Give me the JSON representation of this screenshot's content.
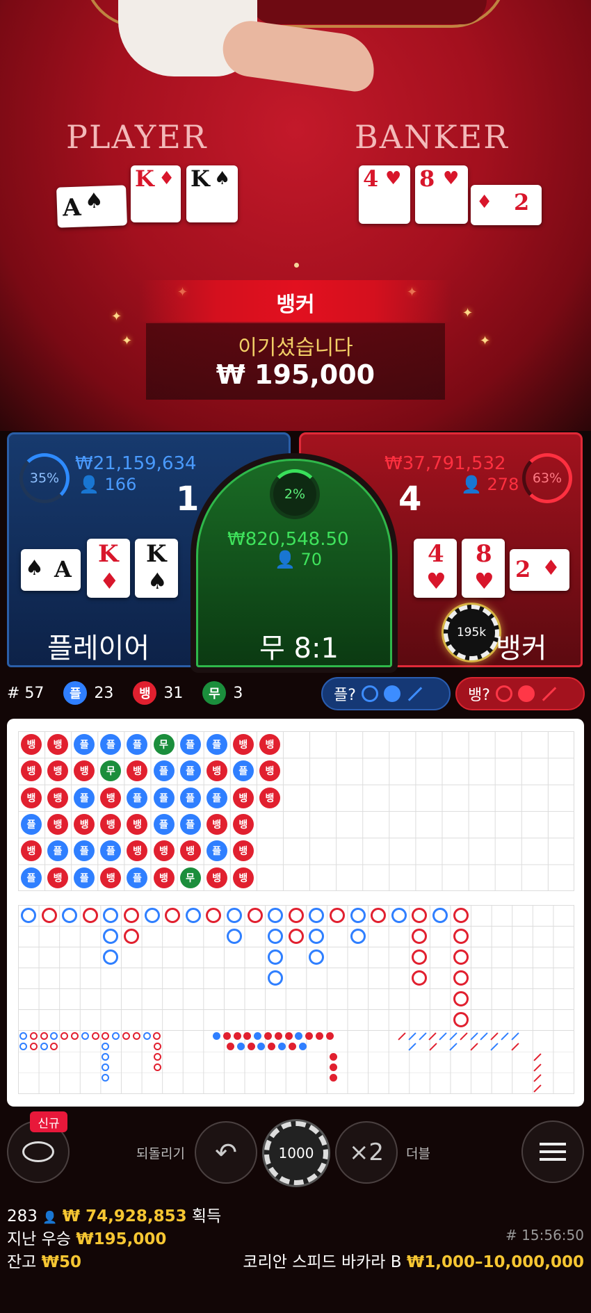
{
  "table": {
    "player_label": "PLAYER",
    "banker_label": "BANKER",
    "player_cards": [
      {
        "rank": "A",
        "suit": "♠",
        "color": "black"
      },
      {
        "rank": "K",
        "suit": "♦",
        "color": "red"
      },
      {
        "rank": "K",
        "suit": "♠",
        "color": "black"
      }
    ],
    "banker_cards": [
      {
        "rank": "4",
        "suit": "♥",
        "color": "red"
      },
      {
        "rank": "8",
        "suit": "♥",
        "color": "red"
      },
      {
        "rank": "2",
        "suit": "♦",
        "color": "red"
      }
    ]
  },
  "result": {
    "winner": "뱅커",
    "message": "이기셨습니다",
    "amount": "₩ 195,000"
  },
  "bets": {
    "player": {
      "pct": "35%",
      "pct_value": 35,
      "amount": "₩21,159,634",
      "players": "166",
      "score": "1",
      "name": "플레이어",
      "cards": [
        {
          "rank": "A",
          "suit": "♠"
        },
        {
          "rank": "K",
          "suit": "♦"
        },
        {
          "rank": "K",
          "suit": "♠"
        }
      ]
    },
    "tie": {
      "pct": "2%",
      "pct_value": 2,
      "amount": "₩820,548.50",
      "players": "70",
      "name": "무 8:1"
    },
    "banker": {
      "pct": "63%",
      "pct_value": 63,
      "amount": "₩37,791,532",
      "players": "278",
      "score": "4",
      "name": "뱅커",
      "chip": "195k",
      "cards": [
        {
          "rank": "4",
          "suit": "♥"
        },
        {
          "rank": "8",
          "suit": "♥"
        },
        {
          "rank": "2",
          "suit": "♦"
        }
      ]
    }
  },
  "stats": {
    "round": "# 57",
    "player_label": "플",
    "player_count": "23",
    "banker_label": "뱅",
    "banker_count": "31",
    "tie_label": "무",
    "tie_count": "3",
    "ask_player": "플?",
    "ask_banker": "뱅?"
  },
  "bead_road": [
    [
      "뱅",
      "뱅",
      "뱅",
      "플",
      "뱅",
      "플"
    ],
    [
      "뱅",
      "뱅",
      "뱅",
      "뱅",
      "플",
      "뱅"
    ],
    [
      "플",
      "뱅",
      "플",
      "뱅",
      "플",
      "플"
    ],
    [
      "플",
      "무",
      "뱅",
      "뱅",
      "플",
      "뱅"
    ],
    [
      "플",
      "뱅",
      "플",
      "뱅",
      "뱅",
      "플"
    ],
    [
      "무",
      "플",
      "플",
      "플",
      "뱅",
      "뱅"
    ],
    [
      "플",
      "플",
      "플",
      "플",
      "뱅",
      "무"
    ],
    [
      "플",
      "뱅",
      "플",
      "뱅",
      "플",
      "뱅"
    ],
    [
      "뱅",
      "플",
      "뱅",
      "뱅",
      "뱅",
      "뱅"
    ],
    [
      "뱅",
      "뱅",
      "뱅",
      "",
      "",
      ""
    ]
  ],
  "controls": {
    "new_badge": "신규",
    "undo_label": "되돌리기",
    "chip_value": "1000",
    "double_symbol": "×2",
    "double_label": "더블"
  },
  "footer": {
    "winners_count": "283",
    "winners_amount": "₩ 74,928,853",
    "winners_suffix": "획득",
    "last_win_label": "지난 우승",
    "last_win_amount": "₩195,000",
    "balance_label": "잔고",
    "balance_amount": "₩50",
    "round_time": "# 15:56:50",
    "table_name": "코리안 스피드 바카라 B",
    "limits": "₩1,000–10,000,000"
  },
  "colors": {
    "player": "#2f7fff",
    "banker": "#e1202f",
    "tie": "#1b8e3c",
    "gold": "#f6c632"
  }
}
